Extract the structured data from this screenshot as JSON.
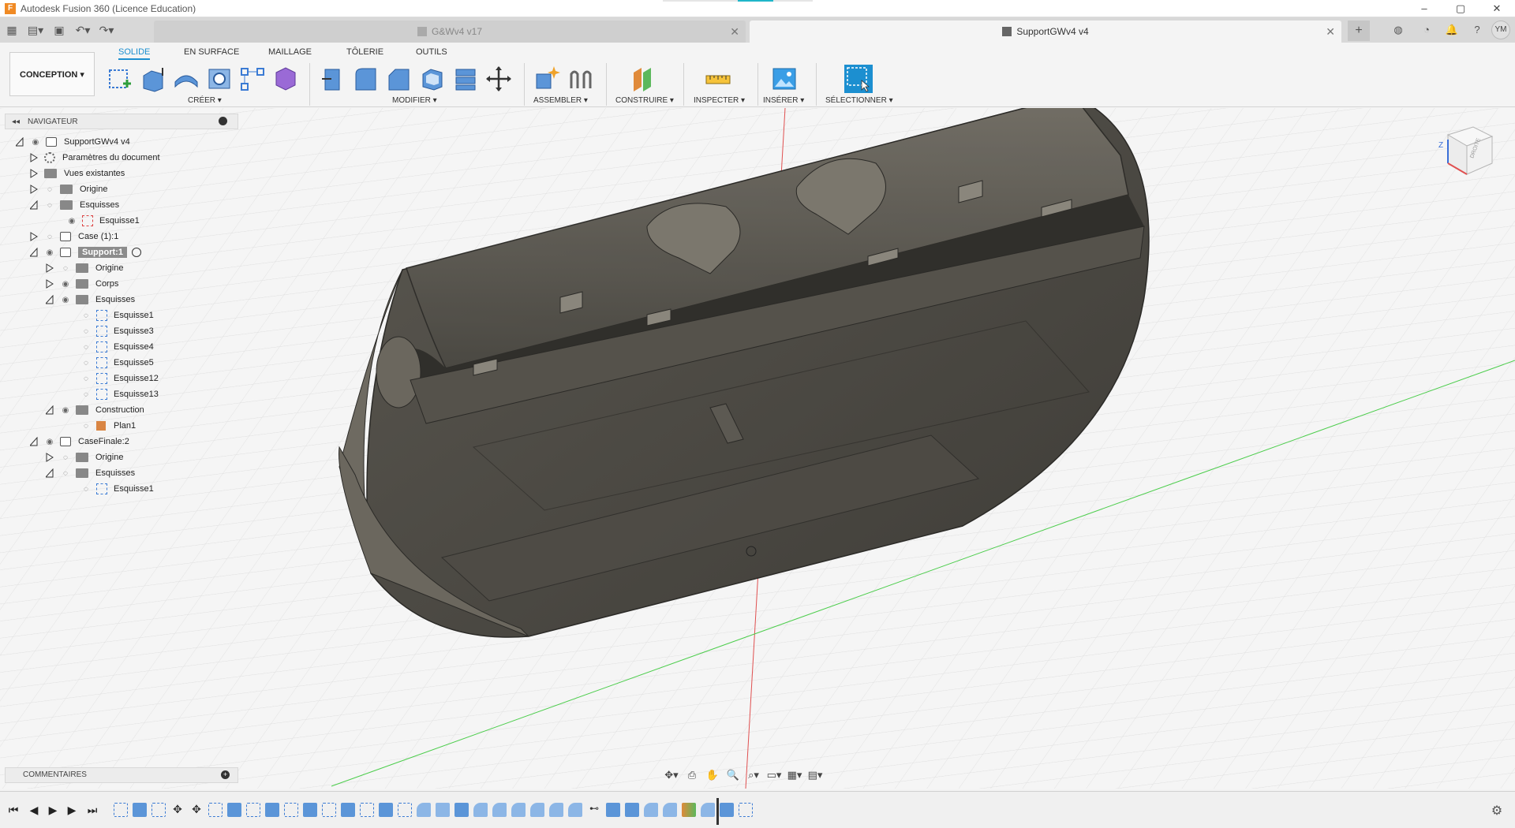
{
  "app": {
    "title": "Autodesk Fusion 360 (Licence Education)",
    "logo": "F"
  },
  "tabs": [
    {
      "label": "G&Wv4 v17",
      "active": false
    },
    {
      "label": "SupportGWv4 v4",
      "active": true
    }
  ],
  "user": {
    "initials": "YM"
  },
  "workspace": {
    "label": "CONCEPTION ▾"
  },
  "ribbon": {
    "tabs": [
      "SOLIDE",
      "EN SURFACE",
      "MAILLAGE",
      "TÔLERIE",
      "OUTILS"
    ],
    "active_tab": "SOLIDE",
    "groups": [
      "CRÉER ▾",
      "MODIFIER ▾",
      "ASSEMBLER ▾",
      "CONSTRUIRE ▾",
      "INSPECTER ▾",
      "INSÉRER ▾",
      "SÉLECTIONNER ▾"
    ]
  },
  "navigator": {
    "title": "NAVIGATEUR",
    "collapse_icon": "◂◂",
    "items": [
      "SupportGWv4 v4",
      "Paramètres du document",
      "Vues existantes",
      "Origine",
      "Esquisses",
      "Esquisse1",
      "Case (1):1",
      "Support:1",
      "Origine",
      "Corps",
      "Esquisses",
      "Esquisse1",
      "Esquisse3",
      "Esquisse4",
      "Esquisse5",
      "Esquisse12",
      "Esquisse13",
      "Construction",
      "Plan1",
      "CaseFinale:2",
      "Origine",
      "Esquisses",
      "Esquisse1"
    ]
  },
  "comments": {
    "label": "COMMENTAIRES"
  },
  "viewcube": {
    "labels": [
      "DROITE",
      "Z"
    ]
  },
  "colors": {
    "accent": "#1c8fd0",
    "model_body": "#4a4842",
    "model_edge": "#2b2a27",
    "axis_red": "#e05050",
    "axis_green": "#4ccd4c",
    "grid": "#dcdcdc"
  }
}
